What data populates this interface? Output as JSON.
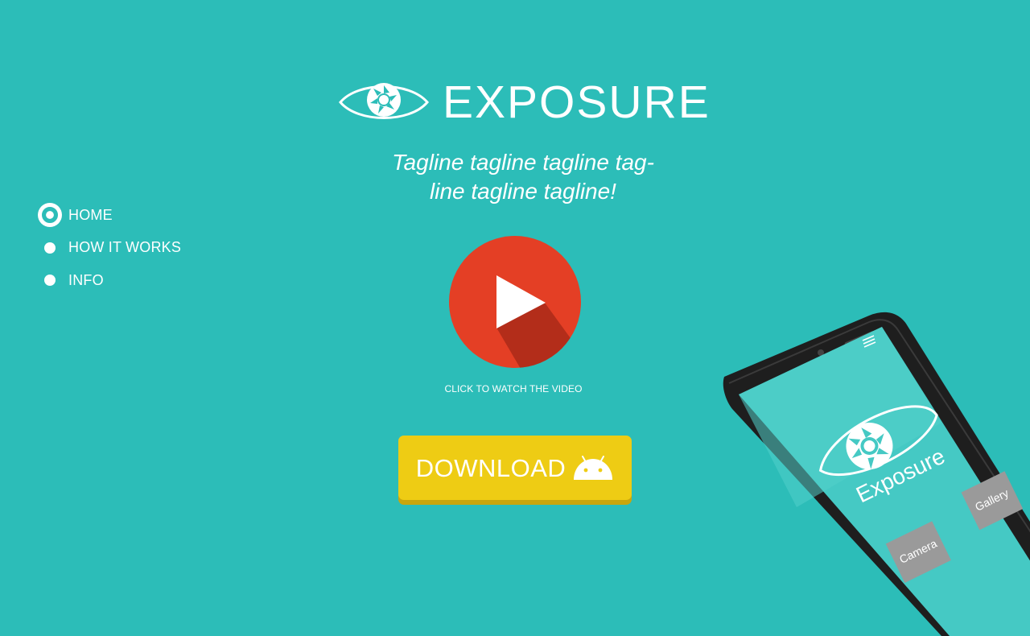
{
  "brand": {
    "name": "EXPOSURE",
    "tagline_line1": "Tagline tagline tagline tag-",
    "tagline_line2": "line tagline tagline!"
  },
  "nav": {
    "items": [
      {
        "label": "HOME",
        "active": true
      },
      {
        "label": "HOW IT WORKS",
        "active": false
      },
      {
        "label": "INFO",
        "active": false
      }
    ]
  },
  "video": {
    "caption": "CLICK TO WATCH THE VIDEO"
  },
  "download": {
    "label": "DOWNLOAD",
    "icon": "android-icon"
  },
  "phone_screen": {
    "app_name": "Exposure",
    "gallery_button": "Gallery",
    "camera_button": "Camera"
  },
  "colors": {
    "background": "#2cbdb8",
    "play_button": "#e43f25",
    "play_shadow": "#b32d1a",
    "download_button": "#eecc14",
    "phone_tile": "#9a9a9a"
  }
}
